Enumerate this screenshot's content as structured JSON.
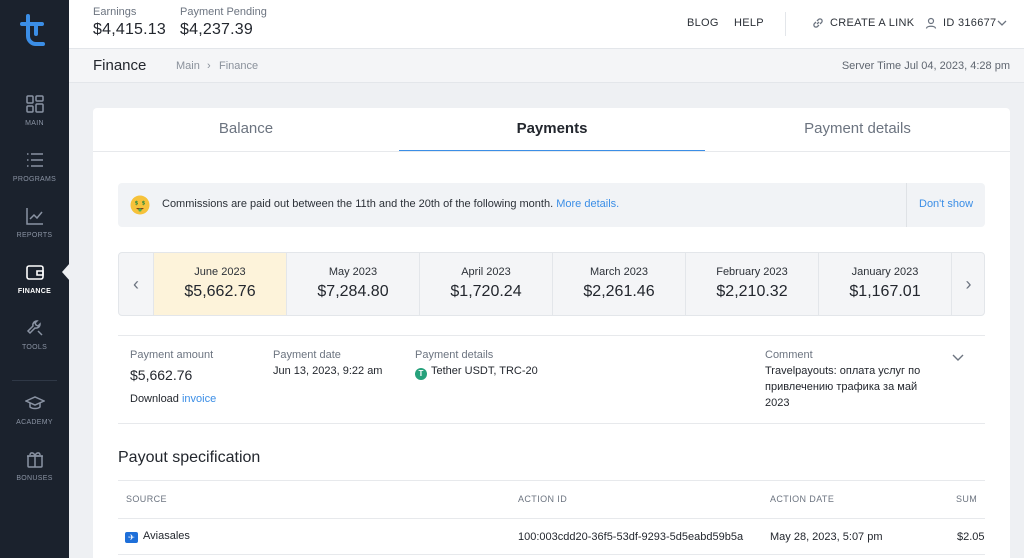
{
  "brand": {
    "accent": "#3b8ee6",
    "sidebar_bg": "#1b222d",
    "highlight": "#fdf3da"
  },
  "sidebar": {
    "items": [
      {
        "label": "MAIN",
        "icon": "dashboard-icon"
      },
      {
        "label": "PROGRAMS",
        "icon": "list-icon"
      },
      {
        "label": "REPORTS",
        "icon": "chart-icon"
      },
      {
        "label": "FINANCE",
        "icon": "wallet-icon",
        "active": true
      },
      {
        "label": "TOOLS",
        "icon": "wrench-icon"
      },
      {
        "label": "ACADEMY",
        "icon": "graduation-cap-icon"
      },
      {
        "label": "BONUSES",
        "icon": "gift-icon"
      }
    ]
  },
  "header": {
    "earnings_label": "Earnings",
    "earnings_value": "$4,415.13",
    "pending_label": "Payment Pending",
    "pending_value": "$4,237.39",
    "blog": "BLOG",
    "help": "HELP",
    "create_link": "CREATE A LINK",
    "user_id": "ID 316677"
  },
  "subheader": {
    "title": "Finance",
    "breadcrumb_main": "Main",
    "breadcrumb_current": "Finance",
    "server_time": "Server Time Jul 04, 2023, 4:28 pm"
  },
  "tabs": [
    {
      "label": "Balance"
    },
    {
      "label": "Payments",
      "active": true
    },
    {
      "label": "Payment details"
    }
  ],
  "notice": {
    "text": "Commissions are paid out between the 11th and the 20th of the following month.",
    "link": "More details.",
    "dismiss": "Don't show"
  },
  "months": [
    {
      "name": "June 2023",
      "value": "$5,662.76",
      "active": true
    },
    {
      "name": "May 2023",
      "value": "$7,284.80"
    },
    {
      "name": "April 2023",
      "value": "$1,720.24"
    },
    {
      "name": "March 2023",
      "value": "$2,261.46"
    },
    {
      "name": "February 2023",
      "value": "$2,210.32"
    },
    {
      "name": "January 2023",
      "value": "$1,167.01"
    }
  ],
  "payment": {
    "amount_label": "Payment amount",
    "amount_value": "$5,662.76",
    "download_label": "Download",
    "invoice_link": "invoice",
    "date_label": "Payment date",
    "date_value": "Jun 13, 2023, 9:22 am",
    "details_label": "Payment details",
    "details_value": "Tether USDT, TRC-20",
    "comment_label": "Comment",
    "comment_line1": "Travelpayouts: оплата услуг по",
    "comment_line2": "привлечению трафика за май",
    "comment_line3": "2023"
  },
  "spec": {
    "title": "Payout specification",
    "columns": {
      "source": "SOURCE",
      "action_id": "ACTION ID",
      "action_date": "ACTION DATE",
      "sum": "SUM"
    },
    "rows": [
      {
        "source": "Aviasales",
        "action_id": "100:003cdd20-36f5-53df-9293-5d5eabd59b5a",
        "action_date": "May 28, 2023, 5:07 pm",
        "sum": "$2.05"
      }
    ]
  }
}
